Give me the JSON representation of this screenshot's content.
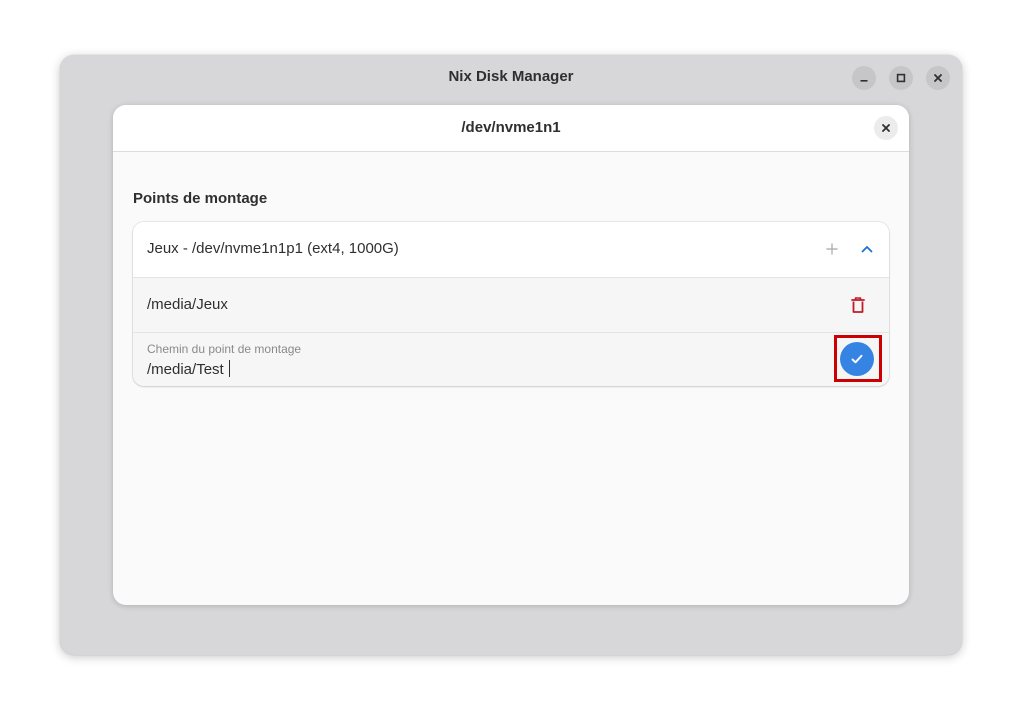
{
  "window": {
    "title": "Nix Disk Manager",
    "controls": [
      "minimize-icon",
      "maximize-icon",
      "close-icon"
    ]
  },
  "dialog": {
    "title": "/dev/nvme1n1",
    "close_icon": "close-icon"
  },
  "section": {
    "title": "Points de montage"
  },
  "partition": {
    "label": "Jeux - /dev/nvme1n1p1 (ext4, 1000G)",
    "add_icon": "plus-icon",
    "expand_icon": "chevron-up-icon",
    "mount_points": [
      {
        "path": "/media/Jeux",
        "delete_icon": "trash-icon"
      }
    ],
    "new_entry": {
      "label": "Chemin du point de montage",
      "value": "/media/Test",
      "confirm_icon": "check-icon"
    }
  },
  "colors": {
    "accent": "#3584e4",
    "destructive": "#c01c28",
    "highlight": "#cc0000"
  }
}
